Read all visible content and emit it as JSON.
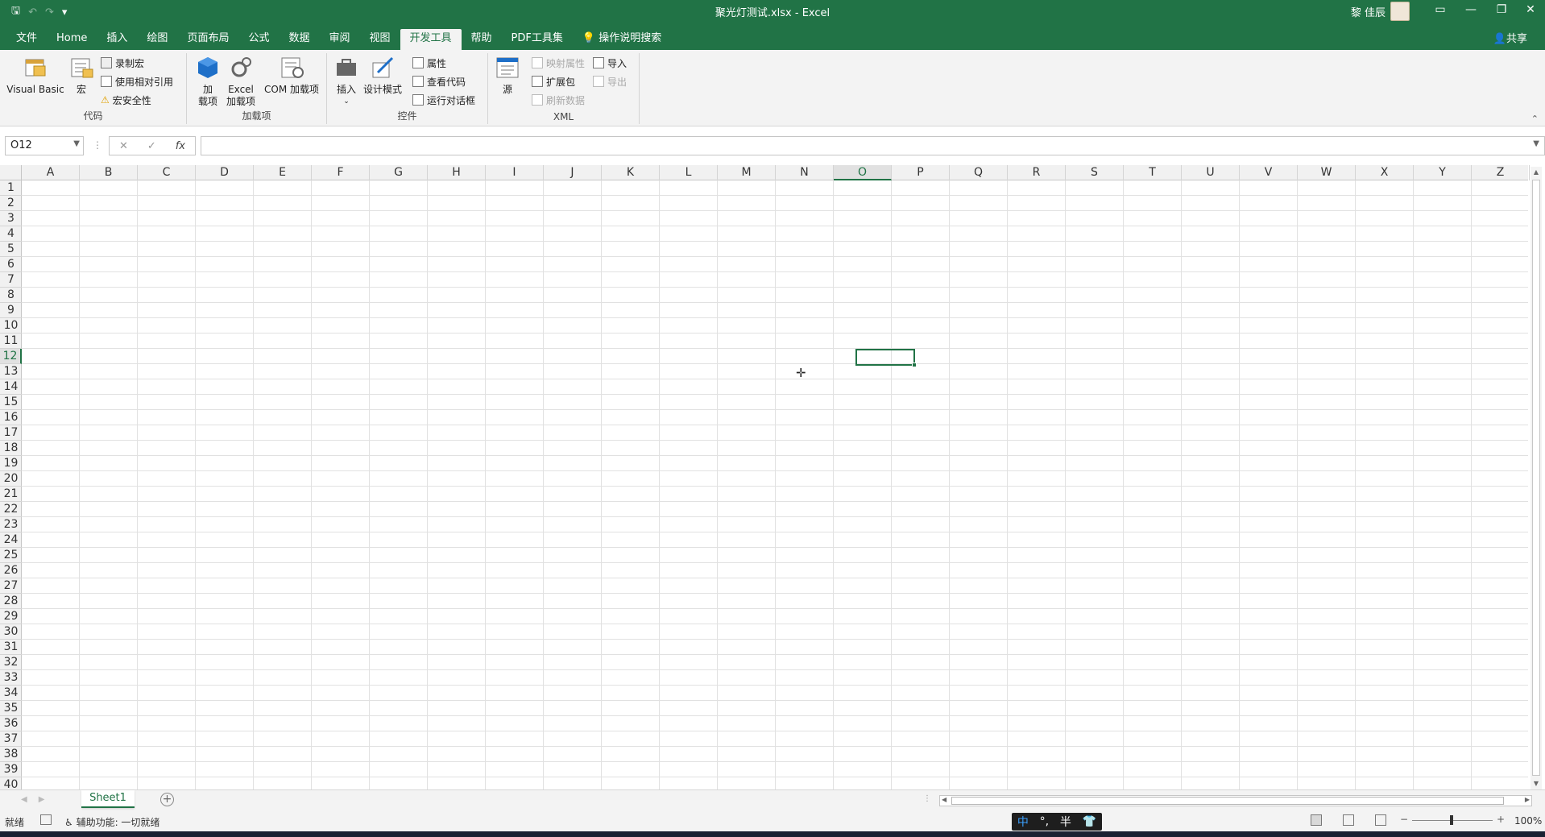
{
  "window": {
    "title": "聚光灯测试.xlsx  -  Excel",
    "user": "黎 佳辰"
  },
  "ribbon_tabs": [
    "文件",
    "Home",
    "插入",
    "绘图",
    "页面布局",
    "公式",
    "数据",
    "审阅",
    "视图",
    "开发工具",
    "帮助",
    "PDF工具集",
    "操作说明搜索"
  ],
  "active_tab": "开发工具",
  "share_label": "共享",
  "ribbon": {
    "code": {
      "label": "代码",
      "visual_basic": "Visual Basic",
      "macros": "宏",
      "record": "录制宏",
      "relative": "使用相对引用",
      "security": "宏安全性"
    },
    "addins": {
      "label": "加载项",
      "addins_btn_l1": "加",
      "addins_btn_l2": "载项",
      "excel_l1": "Excel",
      "excel_l2": "加载项",
      "com": "COM 加载项"
    },
    "controls": {
      "label": "控件",
      "insert": "插入",
      "design": "设计模式",
      "properties": "属性",
      "view_code": "查看代码",
      "run_dialog": "运行对话框"
    },
    "xml": {
      "label": "XML",
      "source": "源",
      "map_props": "映射属性",
      "expansion": "扩展包",
      "refresh": "刷新数据",
      "import": "导入",
      "export": "导出"
    }
  },
  "formula_bar": {
    "name_box": "O12",
    "cancel": "✕",
    "enter": "✓",
    "fx": "fx",
    "value": ""
  },
  "columns": [
    "A",
    "B",
    "C",
    "D",
    "E",
    "F",
    "G",
    "H",
    "I",
    "J",
    "K",
    "L",
    "M",
    "N",
    "O",
    "P",
    "Q",
    "R",
    "S",
    "T",
    "U",
    "V",
    "W",
    "X",
    "Y",
    "Z"
  ],
  "rows": [
    "1",
    "2",
    "3",
    "4",
    "5",
    "6",
    "7",
    "8",
    "9",
    "10",
    "11",
    "12",
    "13",
    "14",
    "15",
    "16",
    "17",
    "18",
    "19",
    "20",
    "21",
    "22",
    "23",
    "24",
    "25",
    "26",
    "27",
    "28",
    "29",
    "30",
    "31",
    "32",
    "33",
    "34",
    "35",
    "36",
    "37",
    "38",
    "39",
    "40"
  ],
  "selected_column": "O",
  "selected_row": "12",
  "sheet_tabs": [
    "Sheet1"
  ],
  "status": {
    "ready": "就绪",
    "accessibility": "辅助功能: 一切就绪",
    "zoom": "100%",
    "ime_lang": "中",
    "ime_punct": "°,",
    "ime_width": "半"
  }
}
